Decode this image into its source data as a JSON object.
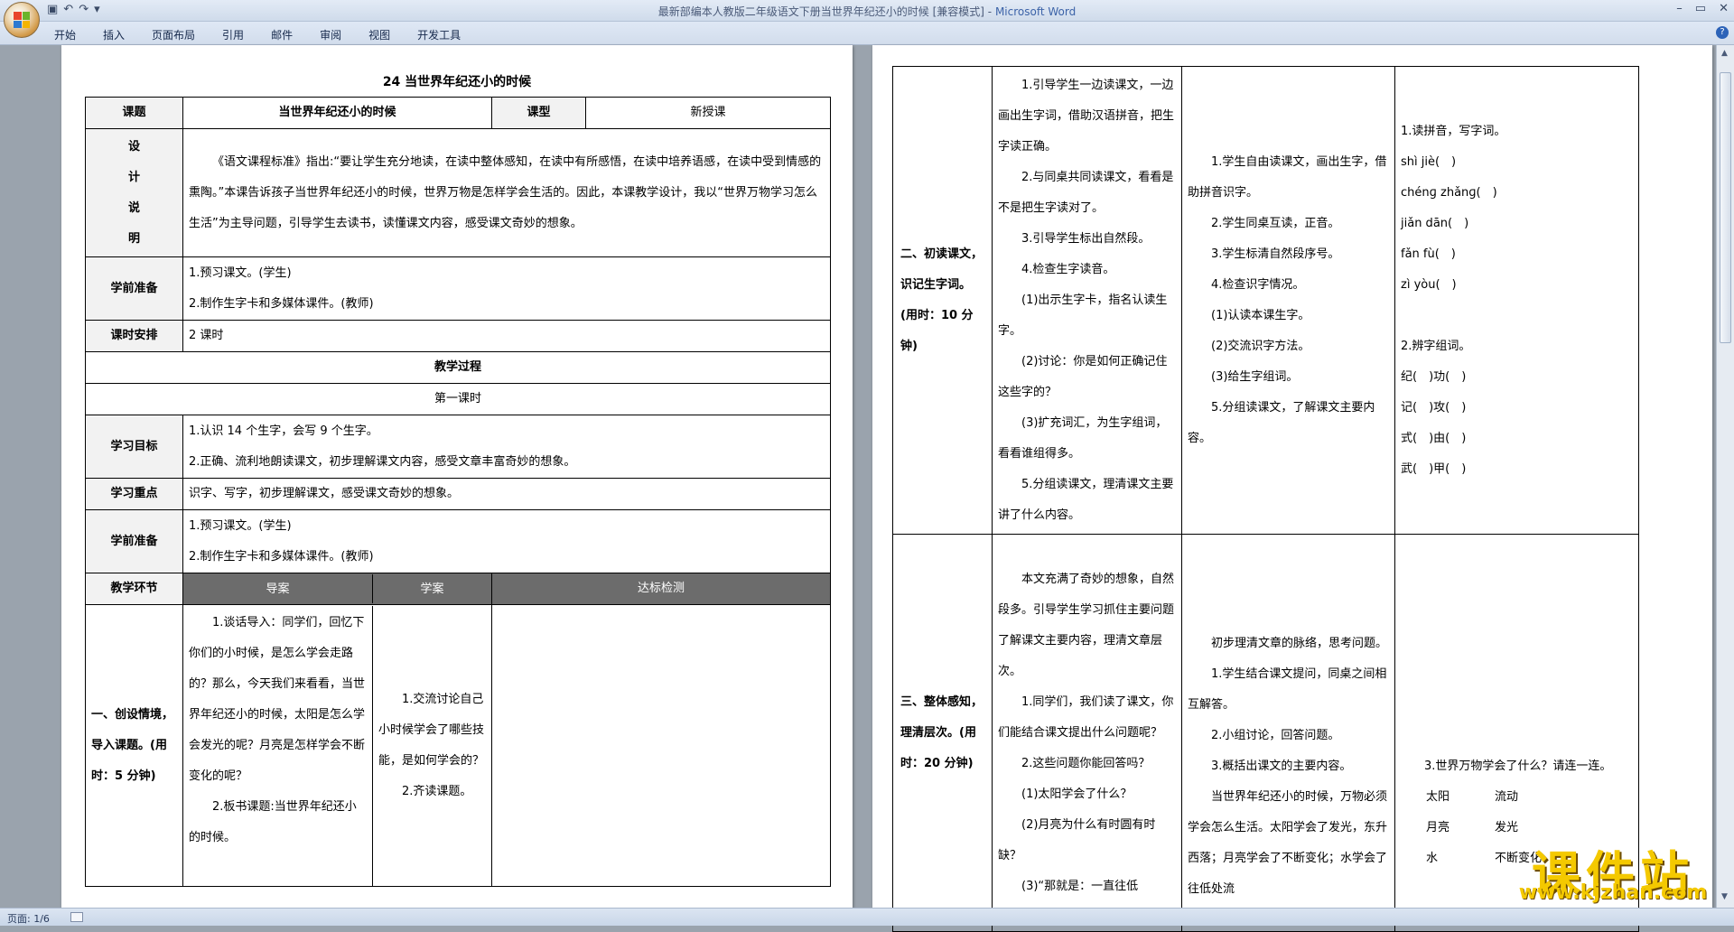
{
  "window": {
    "title": "最新部编本人教版二年级语文下册当世界年纪还小的时候 [兼容模式]",
    "app_name": "Microsoft Word",
    "sep": " - ",
    "qat_icons": [
      "save-icon",
      "undo-icon",
      "redo-icon",
      "customize-icon"
    ]
  },
  "ribbon_tabs": [
    "开始",
    "插入",
    "页面布局",
    "引用",
    "邮件",
    "审阅",
    "视图",
    "开发工具"
  ],
  "status": {
    "page": "页面: 1/6"
  },
  "watermark": {
    "line1": "课件站",
    "line2": "www.kjzhan.com"
  },
  "page1": {
    "title": "24 当世界年纪还小的时候",
    "row_course": {
      "label": "课题",
      "value": "当世界年纪还小的时候",
      "type_label": "课型",
      "type_value": "新授课"
    },
    "row_design": {
      "label": "设计说明",
      "text": "《语文课程标准》指出:“要让学生充分地读，在读中整体感知，在读中有所感悟，在读中培养语感，在读中受到情感的熏陶。”本课告诉孩子当世界年纪还小的时候，世界万物是怎样学会生活的。因此，本课教学设计，我以“世界万物学习怎么生活”为主导问题，引导学生去读书，读懂课文内容，感受课文奇妙的想象。"
    },
    "row_prep": {
      "label": "学前准备",
      "items": [
        "1.预习课文。(学生)",
        "2.制作生字卡和多媒体课件。(教师)"
      ]
    },
    "row_hours": {
      "label": "课时安排",
      "value": "2 课时"
    },
    "process_title": "教学过程",
    "lesson1": "第一课时",
    "row_goals": {
      "label": "学习目标",
      "items": [
        "1.认识 14 个生字，会写 9 个生字。",
        "2.正确、流利地朗读课文，初步理解课文内容，感受文章丰富奇妙的想象。"
      ]
    },
    "row_focus": {
      "label": "学习重点",
      "value": "识字、写字，初步理解课文，感受课文奇妙的想象。"
    },
    "row_prep2": {
      "label": "学前准备",
      "items": [
        "1.预习课文。(学生)",
        "2.制作生字卡和多媒体课件。(教师)"
      ]
    },
    "headers": {
      "label": "教学环节",
      "guide": "导案",
      "study": "学案",
      "check": "达标检测"
    },
    "stage1": {
      "label": "一、创设情境，导入课题。(用时：5 分钟)",
      "guide": [
        "1.谈话导入：同学们，回忆下你们的小时候，是怎么学会走路的？那么，今天我们来看看，当世界年纪还小的时候，太阳是怎么学会发光的呢？月亮是怎样学会不断变化的呢？",
        "2.板书课题:当世界年纪还小的时候。"
      ],
      "study": [
        "1.交流讨论自己小时候学会了哪些技能，是如何学会的？",
        "2.齐读课题。"
      ],
      "check": ""
    }
  },
  "page2": {
    "stage2": {
      "label": "二、初读课文，识记生字词。(用时：10 分钟)",
      "guide": [
        "1.引导学生一边读课文，一边画出生字词，借助汉语拼音，把生字读正确。",
        "2.与同桌共同读课文，看看是不是把生字读对了。",
        "3.引导学生标出自然段。",
        "4.检查生字读音。",
        "(1)出示生字卡，指名认读生字。",
        "(2)讨论：你是如何正确记住这些字的？",
        "(3)扩充词汇，为生字组词，看看谁组得多。",
        "5.分组读课文，理清课文主要讲了什么内容。"
      ],
      "study": [
        "1.学生自由读课文，画出生字，借助拼音识字。",
        "2.学生同桌互读，正音。",
        "3.学生标清自然段序号。",
        "4.检查识字情况。",
        "(1)认读本课生字。",
        "(2)交流识字方法。",
        "(3)给生字组词。",
        "5.分组读课文，了解课文主要内容。"
      ],
      "check": [
        "1.读拼音，写字词。",
        "shì jiè(　)",
        "chénɡ zhǎnɡ(　)",
        "jiǎn dān(　)",
        "fǎn fù(　)",
        "zì yòu(　)",
        "",
        "2.辨字组词。",
        "纪(　)功(　)",
        "记(　)攻(　)",
        "式(　)由(　)",
        "武(　)甲(　)"
      ]
    },
    "stage3": {
      "label": "三、整体感知，理清层次。(用时：20 分钟)",
      "guide": [
        "本文充满了奇妙的想象，自然段多。引导学生学习抓住主要问题了解课文主要内容，理清文章层次。",
        "1.同学们，我们读了课文，你们能结合课文提出什么问题呢？",
        "2.这些问题你能回答吗？",
        "(1)太阳学会了什么？",
        "(2)月亮为什么有时圆有时缺？",
        "(3)“那就是：一直往低"
      ],
      "study": [
        "初步理清文章的脉络，思考问题。",
        "1.学生结合课文提问，同桌之间相互解答。",
        "2.小组讨论，回答问题。",
        "3.概括出课文的主要内容。",
        "当世界年纪还小的时候，万物必须学会怎么生活。太阳学会了发光，东升西落；月亮学会了不断变化；水学会了往低处流"
      ],
      "check_q": "3.世界万物学会了什么？请连一连。",
      "match_left": [
        "太阳",
        "月亮",
        "水"
      ],
      "match_right": [
        "流动",
        "发光",
        "不断变化"
      ]
    }
  }
}
